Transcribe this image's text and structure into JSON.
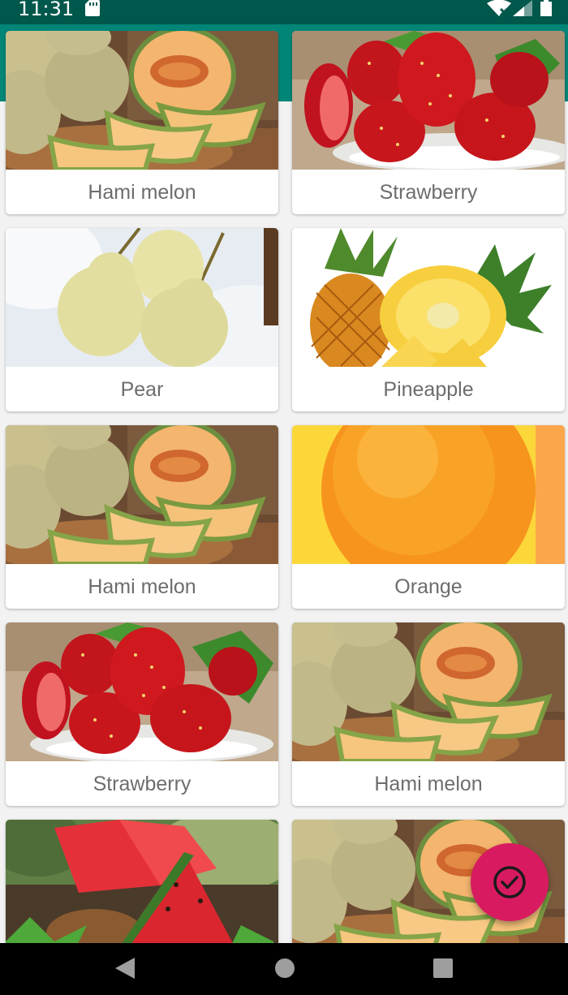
{
  "status_bar": {
    "time": "11:31",
    "icons": [
      "sd-card-icon",
      "wifi-off-icon",
      "signal-icon",
      "battery-icon"
    ]
  },
  "colors": {
    "status_bar": "#00574B",
    "app_bar": "#008577",
    "fab": "#D81B60"
  },
  "fruits": [
    {
      "label": "Hami melon",
      "image": "hami-melon-image"
    },
    {
      "label": "Strawberry",
      "image": "strawberry-image"
    },
    {
      "label": "Pear",
      "image": "pear-image"
    },
    {
      "label": "Pineapple",
      "image": "pineapple-image"
    },
    {
      "label": "Hami melon",
      "image": "hami-melon-image"
    },
    {
      "label": "Orange",
      "image": "orange-image"
    },
    {
      "label": "Strawberry",
      "image": "strawberry-image"
    },
    {
      "label": "Hami melon",
      "image": "hami-melon-image"
    },
    {
      "label": "",
      "image": "watermelon-image"
    },
    {
      "label": "",
      "image": "hami-melon-image"
    }
  ],
  "fab": {
    "icon": "check-circle-icon"
  },
  "nav_bar": {
    "icons": [
      "back-icon",
      "home-icon",
      "recents-icon"
    ]
  }
}
